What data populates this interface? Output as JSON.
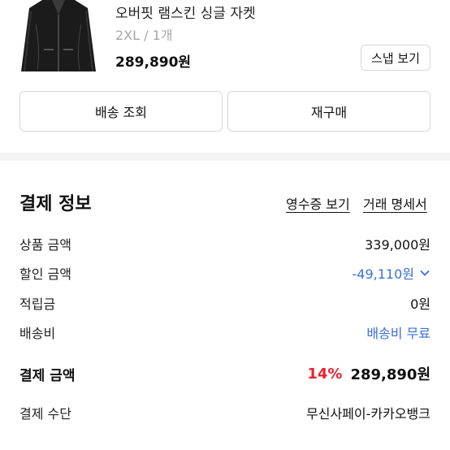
{
  "product": {
    "name": "오버핏 램스킨 싱글 자켓",
    "option": "2XL / 1개",
    "price": "289,890원",
    "snap_button": "스냅 보기",
    "image_icon": "leather-jacket-thumbnail"
  },
  "actions": {
    "delivery": "배송 조회",
    "rebuy": "재구매"
  },
  "payment": {
    "title": "결제 정보",
    "receipt_link": "영수증 보기",
    "statement_link": "거래 명세서",
    "rows": [
      {
        "label": "상품 금액",
        "value": "339,000원"
      },
      {
        "label": "할인 금액",
        "value": "-49,110원"
      },
      {
        "label": "적립금",
        "value": "0원"
      },
      {
        "label": "배송비",
        "value": "배송비 무료"
      }
    ],
    "total": {
      "label": "결제 금액",
      "discount": "14%",
      "value": "289,890원"
    },
    "method": {
      "label": "결제 수단",
      "value": "무신사페이-카카오뱅크"
    }
  },
  "colors": {
    "accent_blue": "#3b6fd4",
    "discount_red": "#e8222e",
    "divider": "#f4f4f4"
  }
}
